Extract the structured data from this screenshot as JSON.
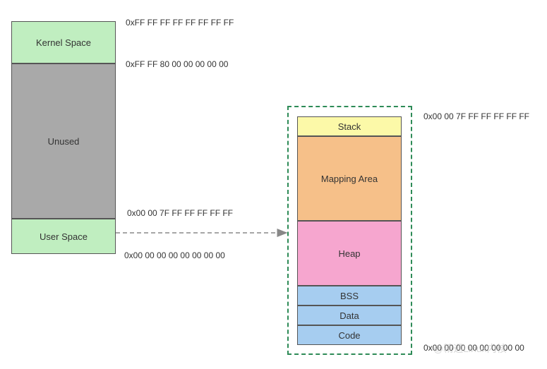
{
  "left": {
    "kernel": "Kernel Space",
    "unused": "Unused",
    "user": "User Space"
  },
  "addresses": {
    "top": "0xFF FF FF FF FF FF FF FF",
    "kernel_base": "0xFF FF 80 00 00 00 00 00",
    "user_top": "0x00 00 7F FF FF FF FF FF",
    "zero": "0x00 00 00 00 00 00 00 00",
    "right_top": "0x00 00 7F FF FF FF FF FF",
    "right_bottom": "0x00 00 00 00 00 00 00 00"
  },
  "right": {
    "stack": "Stack",
    "mapping": "Mapping Area",
    "heap": "Heap",
    "bss": "BSS",
    "data": "Data",
    "code": "Code"
  },
  "watermark": "@精通Linux内核"
}
